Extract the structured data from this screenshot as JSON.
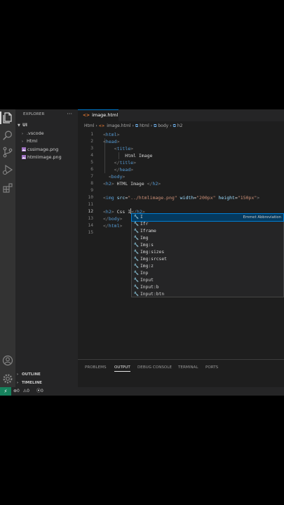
{
  "sidebar": {
    "title": "EXPLORER",
    "menu": "···",
    "root": "UI",
    "items": [
      ".vscode",
      "Html",
      "cssimage.png",
      "htmlimage.png"
    ],
    "sections": [
      "OUTLINE",
      "TIMELINE"
    ]
  },
  "tab": {
    "icon": "<>",
    "label": "image.html"
  },
  "breadcrumbs": [
    "Html",
    "image.html",
    "html",
    "body",
    "h2"
  ],
  "editor": {
    "line_numbers": [
      "1",
      "2",
      "3",
      "4",
      "5",
      "6",
      "7",
      "8",
      "9",
      "10",
      "11",
      "12",
      "13",
      "14",
      "15"
    ],
    "current_line": "12",
    "lines": [
      "<html>",
      "<head>",
      "    <title>",
      "        Html Image",
      "    </title>",
      "    </head>",
      "  <body>",
      "<h2> HTML Image </h2>",
      "",
      "<img src=\"../htmlimage.png\" width=\"200px\" height=\"150px\">",
      "",
      "<h2> Css I</h2>",
      "</body>",
      "</html>",
      ""
    ]
  },
  "suggestions": {
    "detail": "Emmet Abbreviation",
    "items": [
      "I",
      "Ifr",
      "Iframe",
      "Img",
      "Img:s",
      "Img:sizes",
      "Img:srcset",
      "Img:z",
      "Inp",
      "Input",
      "Input:b",
      "Input:btn"
    ]
  },
  "panel": {
    "tabs": [
      "PROBLEMS",
      "OUTPUT",
      "DEBUG CONSOLE",
      "TERMINAL",
      "PORTS"
    ],
    "active": "OUTPUT"
  },
  "status": {
    "errors": "0",
    "warnings": "0",
    "ports": "0"
  },
  "colors": {
    "accent": "#007acc",
    "remote": "#16825d",
    "tag": "#569cd6",
    "attr": "#9cdcfe",
    "string": "#ce9178"
  }
}
